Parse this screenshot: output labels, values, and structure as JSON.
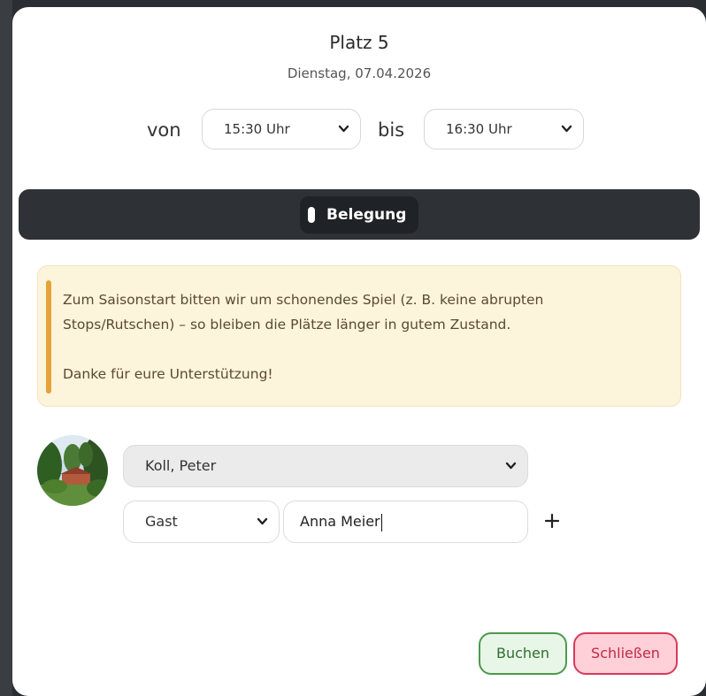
{
  "dialog": {
    "court": "Platz 5",
    "date": "Dienstag, 07.04.2026"
  },
  "time": {
    "from_label": "von",
    "from_value": "15:30 Uhr",
    "to_label": "bis",
    "to_value": "16:30 Uhr"
  },
  "occupancy": {
    "label": "Belegung"
  },
  "notice": {
    "line1": "Zum Saisonstart bitten wir um schonendes Spiel (z. B. keine abrupten",
    "line2": "Stops/Rutschen) – so bleiben die Plätze länger in gutem Zustand.",
    "line3": "Danke für eure Unterstützung!"
  },
  "players": {
    "member_value": "Koll, Peter",
    "guest_type": "Gast",
    "guest_name": "Anna Meier"
  },
  "actions": {
    "book": "Buchen",
    "close": "Schließen"
  },
  "colors": {
    "notice_bg": "#fdf4dc",
    "notice_accent": "#e5a23a",
    "book_border": "#4c9a4c",
    "close_border": "#d93a5a",
    "bar_bg": "#2e3236"
  },
  "icons": {
    "chevron": "chevron-down-icon",
    "add": "plus-icon"
  }
}
